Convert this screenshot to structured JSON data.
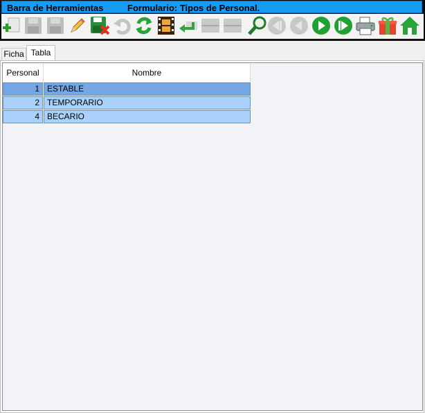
{
  "titlebar": {
    "left_title": "Barra de Herramientas",
    "form_title": "Formulario: Tipos de Personal."
  },
  "toolbar": {
    "buttons": [
      {
        "icon": "add-record-icon",
        "enabled": true
      },
      {
        "icon": "save-icon",
        "enabled": false
      },
      {
        "icon": "save-as-icon",
        "enabled": false
      },
      {
        "icon": "edit-pencil-icon",
        "enabled": true
      },
      {
        "icon": "cancel-save-icon",
        "enabled": true
      },
      {
        "icon": "undo-icon",
        "enabled": false
      },
      {
        "icon": "refresh-icon",
        "enabled": true
      },
      {
        "icon": "film-icon",
        "enabled": true
      },
      {
        "icon": "return-arrow-icon",
        "enabled": true
      },
      {
        "icon": "blank-icon",
        "enabled": false
      },
      {
        "icon": "blank-icon",
        "enabled": false
      },
      {
        "icon": "search-icon",
        "enabled": true
      },
      {
        "icon": "first-record-icon",
        "enabled": false
      },
      {
        "icon": "previous-record-icon",
        "enabled": false
      },
      {
        "icon": "next-record-icon",
        "enabled": true
      },
      {
        "icon": "last-record-icon",
        "enabled": true
      },
      {
        "icon": "printer-icon",
        "enabled": true
      },
      {
        "icon": "gift-icon",
        "enabled": true
      },
      {
        "icon": "home-icon",
        "enabled": true
      }
    ]
  },
  "tabs": [
    {
      "label": "Ficha",
      "active": false
    },
    {
      "label": "Tabla",
      "active": true
    }
  ],
  "table": {
    "columns": [
      "Personal",
      "Nombre"
    ],
    "rows": [
      {
        "personal": "1",
        "nombre": "ESTABLE",
        "selected": true
      },
      {
        "personal": "2",
        "nombre": "TEMPORARIO",
        "selected": false
      },
      {
        "personal": "4",
        "nombre": "BECARIO",
        "selected": false
      }
    ]
  },
  "colors": {
    "title_bar": "#1a9bf2",
    "row_selected": "#75a7e2",
    "row_normal": "#a9d1fa"
  }
}
